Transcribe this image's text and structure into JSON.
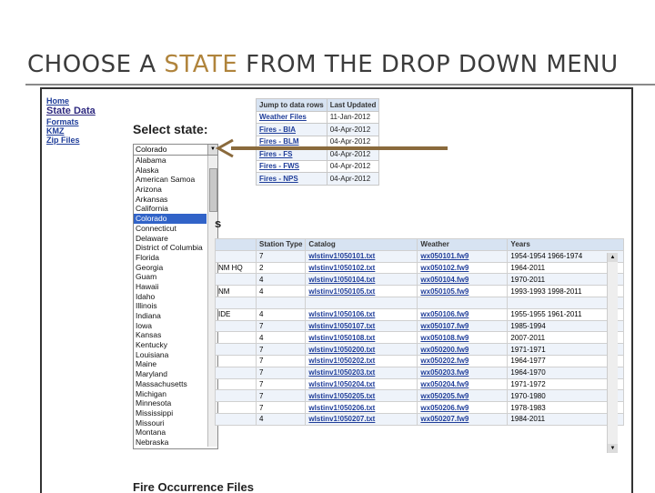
{
  "slide": {
    "title_part1": "CHOOSE A ",
    "title_accent": "STATE",
    "title_part2": " FROM THE DROP DOWN MENU"
  },
  "nav": {
    "items": [
      "Home",
      "State Data",
      "Formats",
      "KMZ",
      "Zip Files"
    ]
  },
  "select": {
    "label": "Select state:",
    "selected": "Colorado",
    "options": [
      "Alabama",
      "Alaska",
      "American Samoa",
      "Arizona",
      "Arkansas",
      "California",
      "Colorado",
      "Connecticut",
      "Delaware",
      "District of Columbia",
      "Florida",
      "Georgia",
      "Guam",
      "Hawaii",
      "Idaho",
      "Illinois",
      "Indiana",
      "Iowa",
      "Kansas",
      "Kentucky",
      "Louisiana",
      "Maine",
      "Maryland",
      "Massachusetts",
      "Michigan",
      "Minnesota",
      "Mississippi",
      "Missouri",
      "Montana",
      "Nebraska"
    ],
    "highlighted_index": 6
  },
  "jump_table": {
    "headers": [
      "Jump to data rows",
      "Last Updated"
    ],
    "rows": [
      [
        "Weather Files",
        "11-Jan-2012"
      ],
      [
        "Fires - BIA",
        "04-Apr-2012"
      ],
      [
        "Fires - BLM",
        "04-Apr-2012"
      ],
      [
        "Fires - FS",
        "04-Apr-2012"
      ],
      [
        "Fires - FWS",
        "04-Apr-2012"
      ],
      [
        "Fires - NPS",
        "04-Apr-2012"
      ]
    ]
  },
  "weather_section": {
    "heading_fragment": "s"
  },
  "data_table": {
    "headers": [
      "",
      "Station Type",
      "Catalog",
      "Weather",
      "Years"
    ],
    "rows": [
      [
        "",
        "7",
        "wlstinv1!050101.txt",
        "wx050101.fw9",
        "1954-1954 1966-1974"
      ],
      [
        "NM HQ",
        "2",
        "wlstinv1!050102.txt",
        "wx050102.fw9",
        "1964-2011"
      ],
      [
        "",
        "4",
        "wlstinv1!050104.txt",
        "wx050104.fw9",
        "1970-2011"
      ],
      [
        "NM",
        "4",
        "wlstinv1!050105.txt",
        "wx050105.fw9",
        "1993-1993 1998-2011"
      ],
      [
        "",
        "",
        "",
        "",
        ""
      ],
      [
        "IDE",
        "4",
        "wlstinv1!050106.txt",
        "wx050106.fw9",
        "1955-1955 1961-2011"
      ],
      [
        "",
        "7",
        "wlstinv1!050107.txt",
        "wx050107.fw9",
        "1985-1994"
      ],
      [
        "",
        "4",
        "wlstinv1!050108.txt",
        "wx050108.fw9",
        "2007-2011"
      ],
      [
        "",
        "7",
        "wlstinv1!050200.txt",
        "wx050200.fw9",
        "1971-1971"
      ],
      [
        "",
        "7",
        "wlstinv1!050202.txt",
        "wx050202.fw9",
        "1964-1977"
      ],
      [
        "",
        "7",
        "wlstinv1!050203.txt",
        "wx050203.fw9",
        "1964-1970"
      ],
      [
        "",
        "7",
        "wlstinv1!050204.txt",
        "wx050204.fw9",
        "1971-1972"
      ],
      [
        "",
        "7",
        "wlstinv1!050205.txt",
        "wx050205.fw9",
        "1970-1980"
      ],
      [
        "",
        "7",
        "wlstinv1!050206.txt",
        "wx050206.fw9",
        "1978-1983"
      ],
      [
        "",
        "4",
        "wlstinv1!050207.txt",
        "wx050207.fw9",
        "1984-2011"
      ]
    ]
  },
  "fire_section": {
    "heading": "Fire Occurrence Files"
  },
  "icons": {
    "dropdown_arrow": "chevron-down-icon",
    "pointer_arrow": "arrow-left-icon"
  },
  "colors": {
    "accent": "#b0843c",
    "link": "#1f3d99",
    "header_bg": "#d7e3f2",
    "selection": "#3163c8",
    "arrow": "#8a6a3c"
  }
}
